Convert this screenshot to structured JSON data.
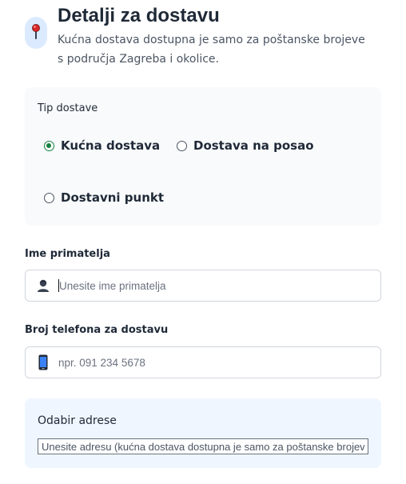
{
  "header": {
    "icon": "pushpin-icon",
    "title": "Detalji za dostavu",
    "subtitle": "Kućna dostava dostupna je samo za poštanske brojeve s područja Zagreba i okolice."
  },
  "delivery_type": {
    "label": "Tip dostave",
    "options": [
      {
        "label": "Kućna dostava",
        "checked": true
      },
      {
        "label": "Dostava na posao",
        "checked": false
      },
      {
        "label": "Dostavni punkt",
        "checked": false
      }
    ]
  },
  "recipient": {
    "label": "Ime primatelja",
    "icon": "person-icon",
    "placeholder": "Unesite ime primatelja",
    "value": ""
  },
  "phone": {
    "label": "Broj telefona za dostavu",
    "icon": "mobile-phone-icon",
    "placeholder": "npr. 091 234 5678",
    "value": ""
  },
  "address": {
    "title": "Odabir adrese",
    "placeholder": "Unesite adresu (kućna dostava dostupna je samo za poštanske brojeve s područja Zagreba i okolice)",
    "value": ""
  },
  "colors": {
    "accent_green": "#15803d",
    "card_gray": "#f8fafc",
    "card_blue": "#eff6ff",
    "badge_blue": "#dbeafe"
  }
}
